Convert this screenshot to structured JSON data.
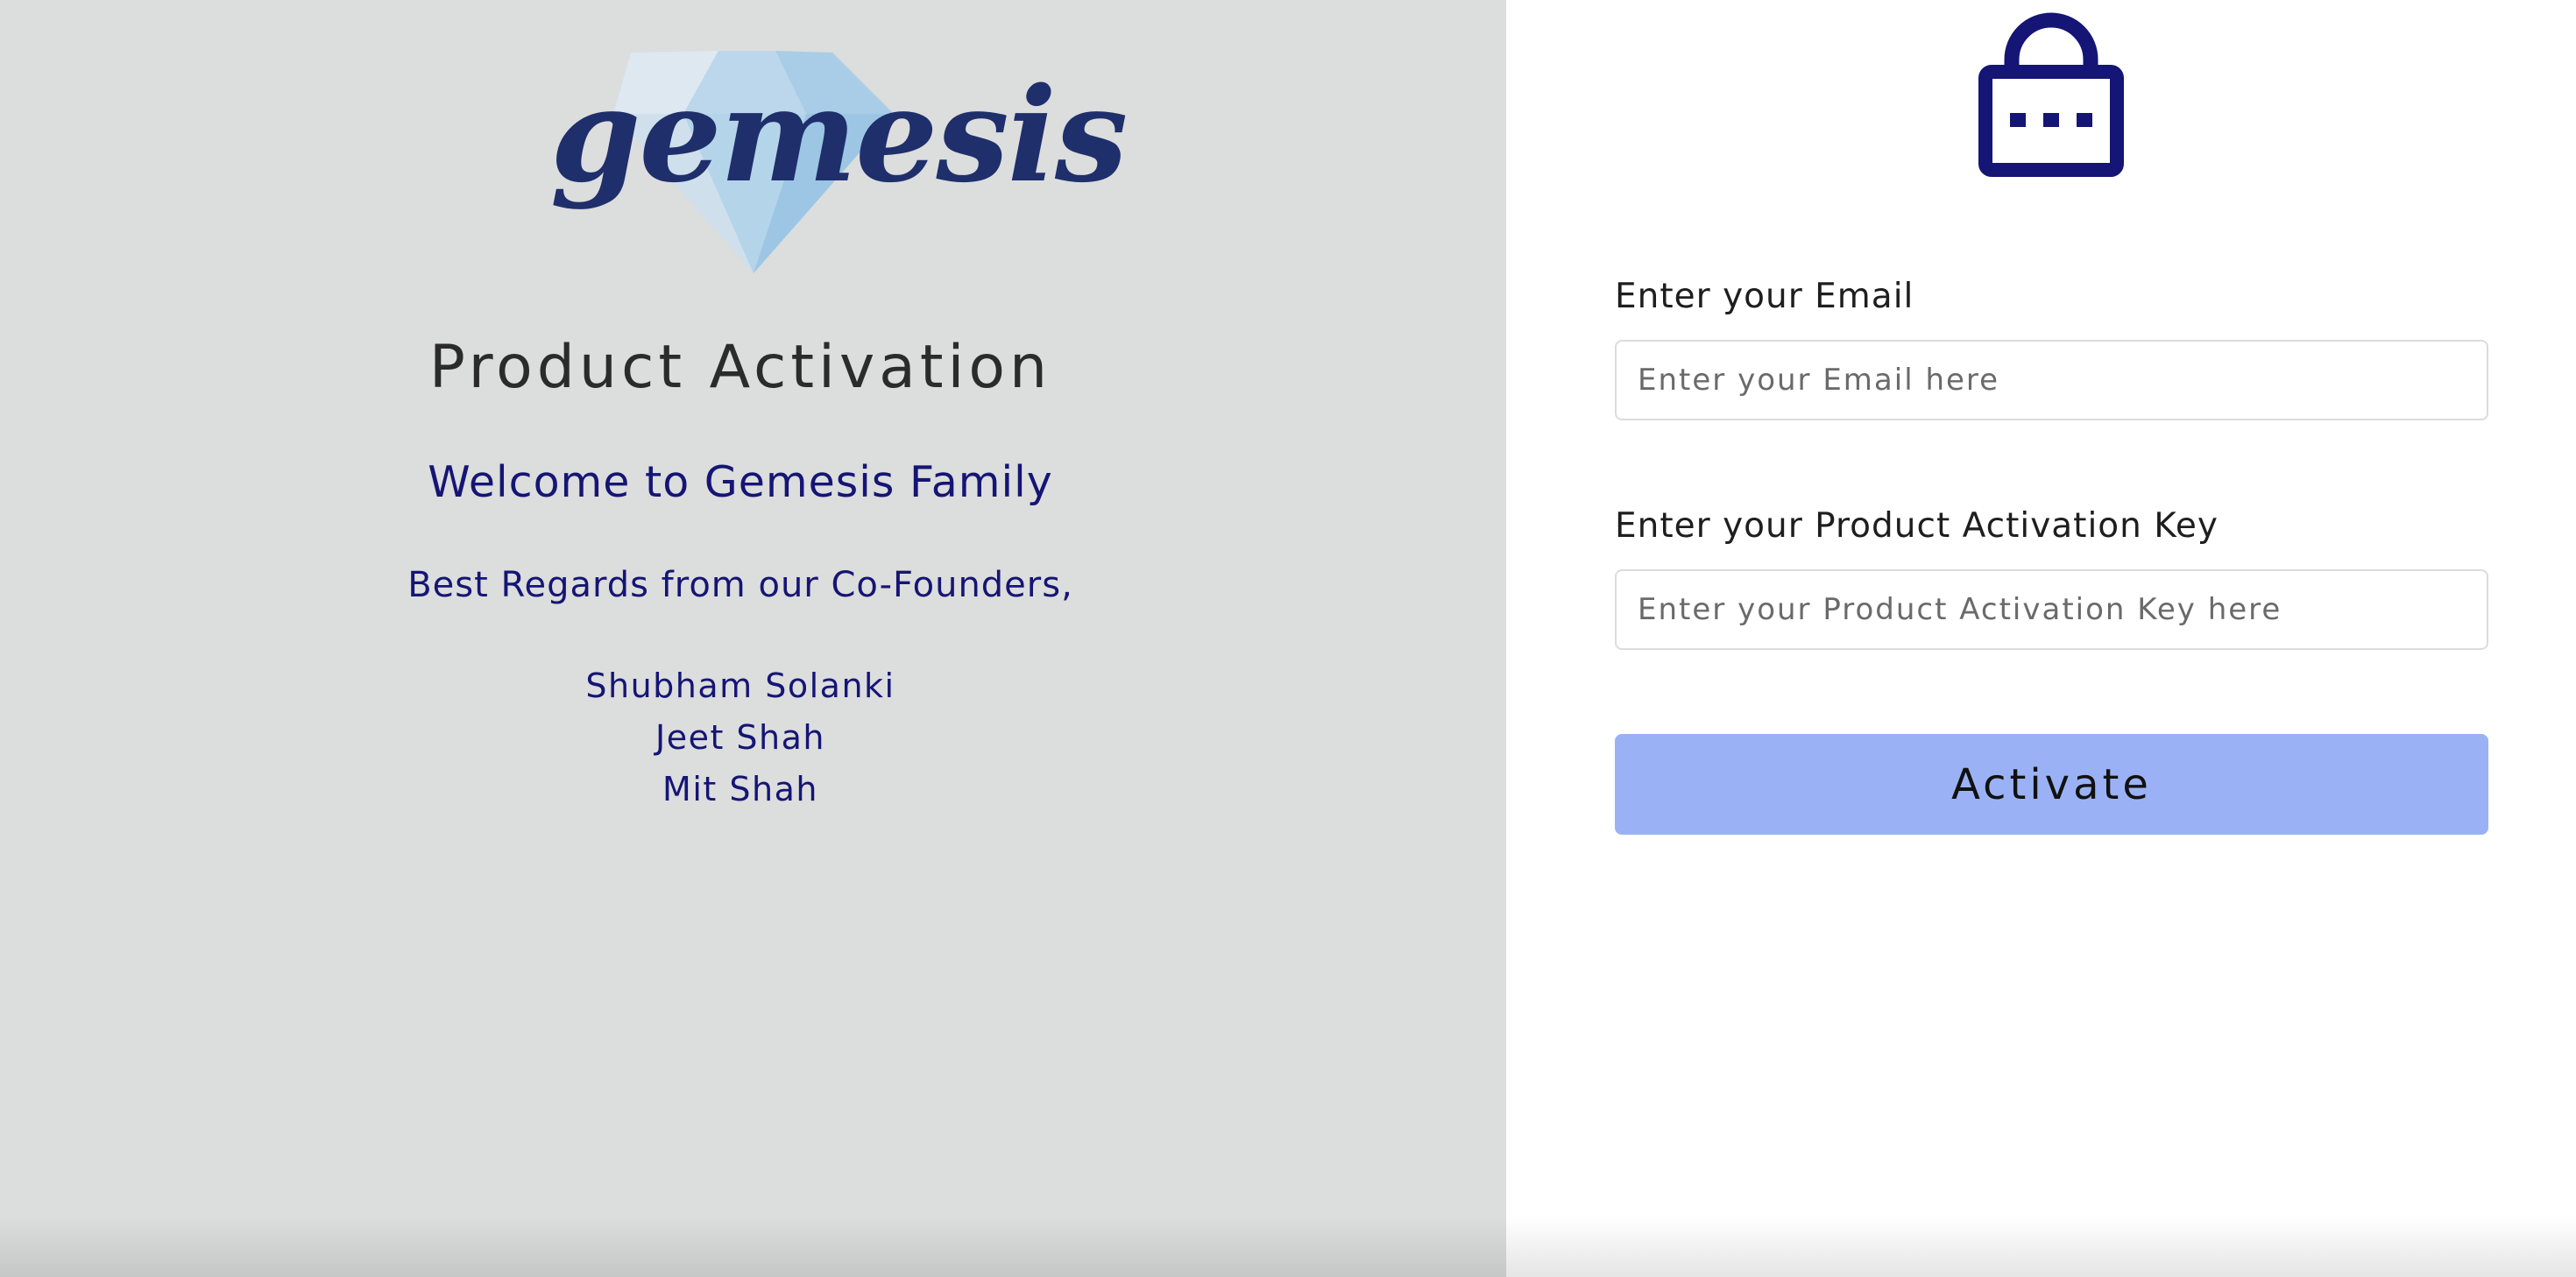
{
  "brand": {
    "logo_text": "gemesis",
    "colors": {
      "navy": "#151575",
      "accent_button": "#9ab2f5",
      "left_panel_bg": "#dcdddd"
    }
  },
  "left": {
    "title": "Product Activation",
    "welcome": "Welcome to Gemesis Family",
    "regards": "Best Regards from our Co-Founders,",
    "founders": [
      "Shubham Solanki",
      "Jeet Shah",
      "Mit Shah"
    ]
  },
  "form": {
    "lock_icon": "lock-icon",
    "email": {
      "label": "Enter your Email",
      "placeholder": "Enter your Email here",
      "value": ""
    },
    "key": {
      "label": "Enter your Product Activation Key",
      "placeholder": "Enter your Product Activation Key here",
      "value": ""
    },
    "activate_label": "Activate"
  }
}
